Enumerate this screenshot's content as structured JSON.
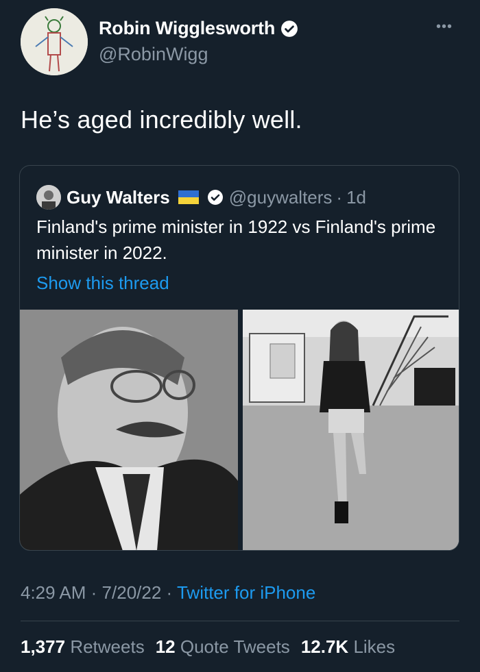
{
  "author": {
    "name": "Robin Wigglesworth",
    "handle": "@RobinWigg"
  },
  "tweet": {
    "text": "He’s aged incredibly well."
  },
  "quoted": {
    "name": "Guy Walters",
    "handle": "@guywalters",
    "sep": "·",
    "age": "1d",
    "text": "Finland's prime minister in 1922 vs Finland's prime minister in 2022.",
    "show_thread": "Show this thread"
  },
  "meta": {
    "time": "4:29 AM",
    "sep1": "·",
    "date": "7/20/22",
    "sep2": "·",
    "source": "Twitter for iPhone"
  },
  "stats": {
    "retweets_count": "1,377",
    "retweets_label": "Retweets",
    "quotes_count": "12",
    "quotes_label": "Quote Tweets",
    "likes_count": "12.7K",
    "likes_label": "Likes"
  },
  "icons": {
    "verified": "verified-badge-icon",
    "more": "more-options-icon",
    "flag": "ukraine-flag-icon"
  },
  "colors": {
    "background": "#15202b",
    "accent": "#1d9bf0",
    "secondary_text": "#8b98a5",
    "border": "#38444d"
  }
}
